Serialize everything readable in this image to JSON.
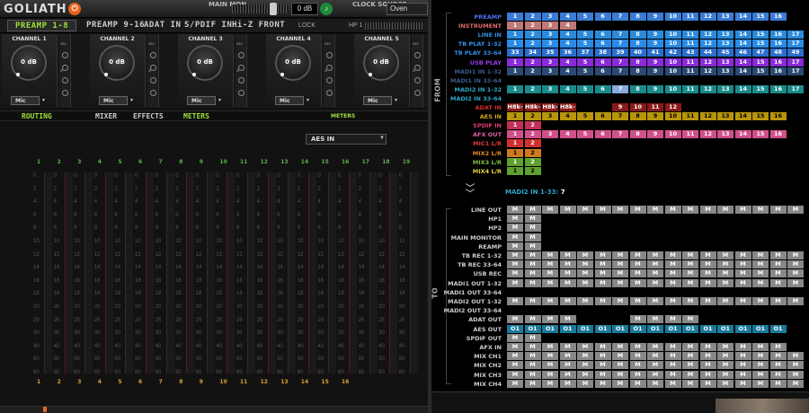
{
  "top": {
    "logo": "GOLIATH",
    "power_icon": "power-icon",
    "main_mon_label": "MAIN MON",
    "volume": "0 dB",
    "clock_label": "CLOCK SOURCE",
    "clock_value": "Oven"
  },
  "tabs": [
    "PREAMP 1-8",
    "PREAMP 9-16",
    "ADAT IN",
    "S/PDIF IN",
    "Hi-Z FRONT"
  ],
  "lock_label": "LOCK",
  "hp_label": "HP 1",
  "channels": [
    {
      "label": "CHANNEL 1",
      "gain": "0 dB",
      "input": "Mic"
    },
    {
      "label": "CHANNEL 2",
      "gain": "0 dB",
      "input": "Mic"
    },
    {
      "label": "CHANNEL 3",
      "gain": "0 dB",
      "input": "Mic"
    },
    {
      "label": "CHANNEL 4",
      "gain": "0 dB",
      "input": "Mic"
    },
    {
      "label": "CHANNEL 5",
      "gain": "0 dB",
      "input": "Mic"
    }
  ],
  "route_tabs": [
    "ROUTING",
    "MIXER",
    "EFFECTS",
    "METERS"
  ],
  "meters_title": "METERS",
  "meter_source": "AES IN",
  "meter_top_numbers": [
    "1",
    "2",
    "3",
    "4",
    "5",
    "6",
    "7",
    "8",
    "9",
    "10",
    "11",
    "12",
    "13",
    "14",
    "15",
    "16",
    "17",
    "18",
    "19"
  ],
  "meter_bottom_numbers": [
    "1",
    "2",
    "3",
    "4",
    "5",
    "6",
    "7",
    "8",
    "9",
    "10",
    "11",
    "12",
    "13",
    "14",
    "15",
    "16"
  ],
  "meter_scale": [
    "0",
    "2",
    "4",
    "6",
    "8",
    "10",
    "12",
    "14",
    "16",
    "18",
    "20",
    "25",
    "30",
    "40",
    "50",
    "60"
  ],
  "matrix": {
    "from_label": "FROM",
    "to_label": "TO",
    "from_rows": [
      {
        "label": "PREAMP",
        "color": "#3a7bd5",
        "lcolor": "#4a6ff0",
        "cells": [
          "1",
          "2",
          "3",
          "4",
          "5",
          "6",
          "7",
          "8",
          "9",
          "10",
          "11",
          "12",
          "13",
          "14",
          "15",
          "16"
        ]
      },
      {
        "label": "INSTRUMENT",
        "color": "#c07878",
        "lcolor": "#e06a6a",
        "cells": [
          "1",
          "2",
          "3",
          "4"
        ]
      },
      {
        "label": "LINE IN",
        "color": "#2a8bdc",
        "lcolor": "#2f8fe6",
        "cells": [
          "1",
          "2",
          "3",
          "4",
          "5",
          "6",
          "7",
          "8",
          "9",
          "10",
          "11",
          "12",
          "13",
          "14",
          "15",
          "16",
          "17"
        ]
      },
      {
        "label": "TB PLAY 1-32",
        "color": "#2a8be6",
        "lcolor": "#2f8fe6",
        "cells": [
          "1",
          "2",
          "3",
          "4",
          "5",
          "6",
          "7",
          "8",
          "9",
          "10",
          "11",
          "12",
          "13",
          "14",
          "15",
          "16",
          "17"
        ]
      },
      {
        "label": "TB PLAY 33-64",
        "color": "#2a6fcc",
        "lcolor": "#2f8fe6",
        "cells": [
          "33",
          "34",
          "35",
          "36",
          "37",
          "38",
          "39",
          "40",
          "41",
          "42",
          "43",
          "44",
          "45",
          "46",
          "47",
          "48",
          "49"
        ]
      },
      {
        "label": "USB PLAY",
        "color": "#8a2ad8",
        "lcolor": "#9a3af0",
        "cells": [
          "1",
          "2",
          "3",
          "4",
          "5",
          "6",
          "7",
          "8",
          "9",
          "10",
          "11",
          "12",
          "13",
          "14",
          "15",
          "16",
          "17"
        ]
      },
      {
        "label": "MADI1 IN 1-32",
        "color": "#2a4a72",
        "lcolor": "#3a5a8a",
        "cells": [
          "1",
          "2",
          "3",
          "4",
          "5",
          "6",
          "7",
          "8",
          "9",
          "10",
          "11",
          "12",
          "13",
          "14",
          "15",
          "16",
          "17"
        ]
      },
      {
        "label": "MADI1 IN 33-64",
        "color": "#2a4a72",
        "lcolor": "#3a5a8a",
        "cells": []
      },
      {
        "label": "MADI2 IN 1-32",
        "color": "#1a8a8a",
        "lcolor": "#2ea6c8",
        "cells": [
          "1",
          "2",
          "3",
          "4",
          "5",
          "6",
          "7",
          "8",
          "9",
          "10",
          "11",
          "12",
          "13",
          "14",
          "15",
          "16",
          "17"
        ]
      },
      {
        "label": "MADI2 IN 33-64",
        "color": "#1a6a6a",
        "lcolor": "#2ea6c8",
        "cells": []
      },
      {
        "label": "ADAT IN",
        "color": "#8a1a1a",
        "lcolor": "#d02a2a",
        "cells": [
          "H8k-1",
          "H8k-2",
          "H8k-3",
          "H8k-4",
          "",
          "",
          "9",
          "10",
          "11",
          "12"
        ]
      },
      {
        "label": "AES IN",
        "color": "#b8960a",
        "lcolor": "#d8a020",
        "cells": [
          "1",
          "2",
          "3",
          "4",
          "5",
          "6",
          "7",
          "8",
          "9",
          "10",
          "11",
          "12",
          "13",
          "14",
          "15",
          "16"
        ]
      },
      {
        "label": "SPDIF IN",
        "color": "#c0305a",
        "lcolor": "#e03a70",
        "cells": [
          "1",
          "2"
        ]
      },
      {
        "label": "AFX OUT",
        "color": "#d0508a",
        "lcolor": "#e060a0",
        "cells": [
          "1",
          "2",
          "3",
          "4",
          "5",
          "6",
          "7",
          "8",
          "9",
          "10",
          "11",
          "12",
          "13",
          "14",
          "15",
          "16"
        ]
      },
      {
        "label": "MIC1 L/R",
        "color": "#d03030",
        "lcolor": "#e03a3a",
        "cells": [
          "1",
          "2"
        ]
      },
      {
        "label": "MIX2 L/R",
        "color": "#d07a20",
        "lcolor": "#e08a2a",
        "cells": [
          "1",
          "2"
        ]
      },
      {
        "label": "MIX3 L/R",
        "color": "#60a030",
        "lcolor": "#7ac040",
        "cells": [
          "1",
          "2"
        ]
      },
      {
        "label": "MIX4 L/R",
        "color": "#60a030",
        "lcolor": "#e0d040",
        "cells": [
          "1",
          "2"
        ]
      }
    ],
    "madi_info_label": "MADI2 IN 1-33:",
    "madi_info_value": "7",
    "to_rows": [
      {
        "label": "LINE OUT",
        "cells": [
          "M",
          "M",
          "M",
          "M",
          "M",
          "M",
          "M",
          "M",
          "M",
          "M",
          "M",
          "M",
          "M",
          "M",
          "M",
          "M",
          "M"
        ]
      },
      {
        "label": "HP1",
        "cells": [
          "M",
          "M"
        ]
      },
      {
        "label": "HP2",
        "cells": [
          "M",
          "M"
        ]
      },
      {
        "label": "MAIN MONITOR",
        "cells": [
          "M",
          "M"
        ]
      },
      {
        "label": "REAMP",
        "cells": [
          "M",
          "M"
        ]
      },
      {
        "label": "TB REC 1-32",
        "cells": [
          "M",
          "M",
          "M",
          "M",
          "M",
          "M",
          "M",
          "M",
          "M",
          "M",
          "M",
          "M",
          "M",
          "M",
          "M",
          "M",
          "M"
        ]
      },
      {
        "label": "TB REC 33-64",
        "cells": [
          "M",
          "M",
          "M",
          "M",
          "M",
          "M",
          "M",
          "M",
          "M",
          "M",
          "M",
          "M",
          "M",
          "M",
          "M",
          "M",
          "M"
        ]
      },
      {
        "label": "USB REC",
        "cells": [
          "M",
          "M",
          "M",
          "M",
          "M",
          "M",
          "M",
          "M",
          "M",
          "M",
          "M",
          "M",
          "M",
          "M",
          "M",
          "M",
          "M"
        ]
      },
      {
        "label": "MADI1 OUT 1-32",
        "cells": [
          "M",
          "M",
          "M",
          "M",
          "M",
          "M",
          "M",
          "M",
          "M",
          "M",
          "M",
          "M",
          "M",
          "M",
          "M",
          "M",
          "M"
        ]
      },
      {
        "label": "MADI1 OUT 33-64",
        "cells": []
      },
      {
        "label": "MADI2 OUT 1-32",
        "cells": [
          "M",
          "M",
          "M",
          "M",
          "M",
          "M",
          "M",
          "M",
          "M",
          "M",
          "M",
          "M",
          "M",
          "M",
          "M",
          "M",
          "M"
        ]
      },
      {
        "label": "MADI2 OUT 33-64",
        "cells": []
      },
      {
        "label": "ADAT OUT",
        "cells": [
          "M",
          "M",
          "M",
          "M",
          "",
          "",
          "",
          "M",
          "M",
          "M",
          "M"
        ]
      },
      {
        "label": "AES OUT",
        "cells": [
          "O1",
          "O1",
          "O1",
          "O1",
          "O1",
          "O1",
          "O1",
          "O1",
          "O1",
          "O1",
          "O1",
          "O1",
          "O1",
          "O1",
          "O1",
          "O1"
        ]
      },
      {
        "label": "SPDIF OUT",
        "cells": [
          "M",
          "M"
        ]
      },
      {
        "label": "AFX IN",
        "cells": [
          "M",
          "M",
          "M",
          "M",
          "M",
          "M",
          "M",
          "M",
          "M",
          "M",
          "M",
          "M",
          "M",
          "M",
          "M",
          "M"
        ]
      },
      {
        "label": "MIX CH1",
        "cells": [
          "M",
          "M",
          "M",
          "M",
          "M",
          "M",
          "M",
          "M",
          "M",
          "M",
          "M",
          "M",
          "M",
          "M",
          "M",
          "M",
          "M"
        ]
      },
      {
        "label": "MIX CH2",
        "cells": [
          "M",
          "M",
          "M",
          "M",
          "M",
          "M",
          "M",
          "M",
          "M",
          "M",
          "M",
          "M",
          "M",
          "M",
          "M",
          "M",
          "M"
        ]
      },
      {
        "label": "MIX CH3",
        "cells": [
          "M",
          "M",
          "M",
          "M",
          "M",
          "M",
          "M",
          "M",
          "M",
          "M",
          "M",
          "M",
          "M",
          "M",
          "M",
          "M",
          "M"
        ]
      },
      {
        "label": "MIX CH4",
        "cells": [
          "M",
          "M",
          "M",
          "M",
          "M",
          "M",
          "M",
          "M",
          "M",
          "M",
          "M",
          "M",
          "M",
          "M",
          "M",
          "M",
          "M"
        ]
      }
    ]
  }
}
